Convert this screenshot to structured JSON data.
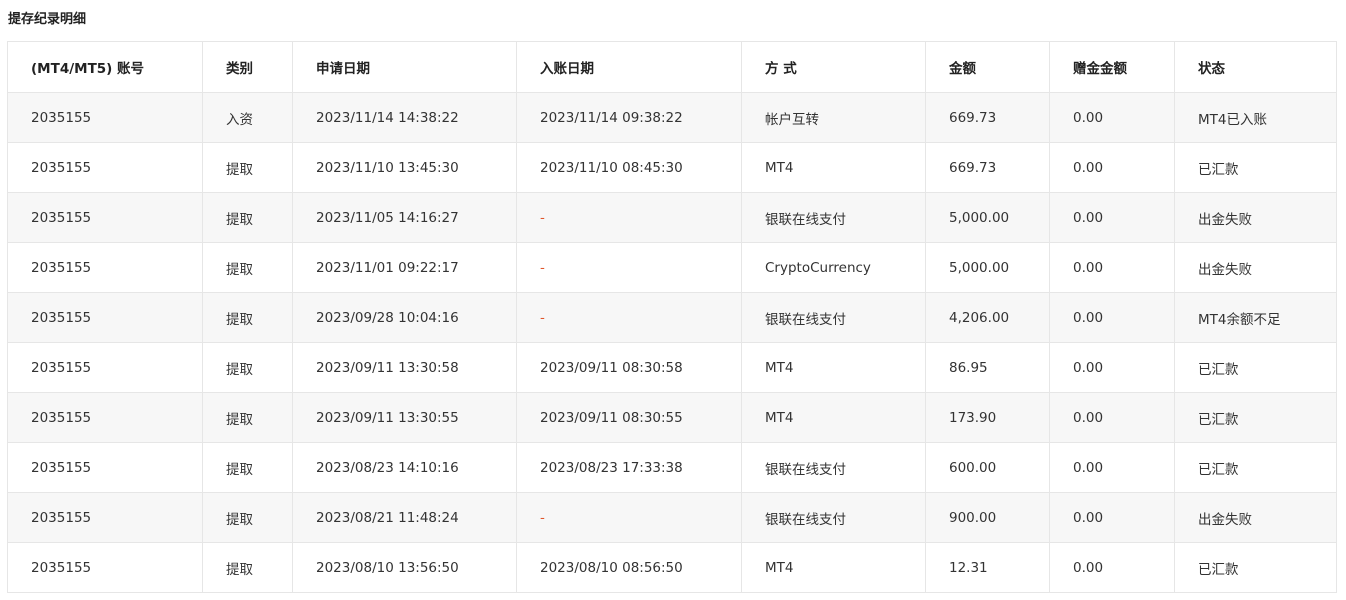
{
  "page": {
    "title": "提存纪录明细"
  },
  "table": {
    "columns": [
      "(MT4/MT5) 账号",
      "类别",
      "申请日期",
      "入账日期",
      "方 式",
      "金额",
      "赠金金额",
      "状态"
    ],
    "rows": [
      [
        "2035155",
        "入资",
        "2023/11/14 14:38:22",
        "2023/11/14 09:38:22",
        "帐户互转",
        "669.73",
        "0.00",
        "MT4已入账"
      ],
      [
        "2035155",
        "提取",
        "2023/11/10 13:45:30",
        "2023/11/10 08:45:30",
        "MT4",
        "669.73",
        "0.00",
        "已汇款"
      ],
      [
        "2035155",
        "提取",
        "2023/11/05 14:16:27",
        "-",
        "银联在线支付",
        "5,000.00",
        "0.00",
        "出金失败"
      ],
      [
        "2035155",
        "提取",
        "2023/11/01 09:22:17",
        "-",
        "CryptoCurrency",
        "5,000.00",
        "0.00",
        "出金失败"
      ],
      [
        "2035155",
        "提取",
        "2023/09/28 10:04:16",
        "-",
        "银联在线支付",
        "4,206.00",
        "0.00",
        "MT4余额不足"
      ],
      [
        "2035155",
        "提取",
        "2023/09/11 13:30:58",
        "2023/09/11 08:30:58",
        "MT4",
        "86.95",
        "0.00",
        "已汇款"
      ],
      [
        "2035155",
        "提取",
        "2023/09/11 13:30:55",
        "2023/09/11 08:30:55",
        "MT4",
        "173.90",
        "0.00",
        "已汇款"
      ],
      [
        "2035155",
        "提取",
        "2023/08/23 14:10:16",
        "2023/08/23 17:33:38",
        "银联在线支付",
        "600.00",
        "0.00",
        "已汇款"
      ],
      [
        "2035155",
        "提取",
        "2023/08/21 11:48:24",
        "-",
        "银联在线支付",
        "900.00",
        "0.00",
        "出金失败"
      ],
      [
        "2035155",
        "提取",
        "2023/08/10 13:56:50",
        "2023/08/10 08:56:50",
        "MT4",
        "12.31",
        "0.00",
        "已汇款"
      ]
    ]
  },
  "colors": {
    "dash": "#e0562b",
    "stripe": "#f7f7f7",
    "border": "#e6e6e6"
  }
}
